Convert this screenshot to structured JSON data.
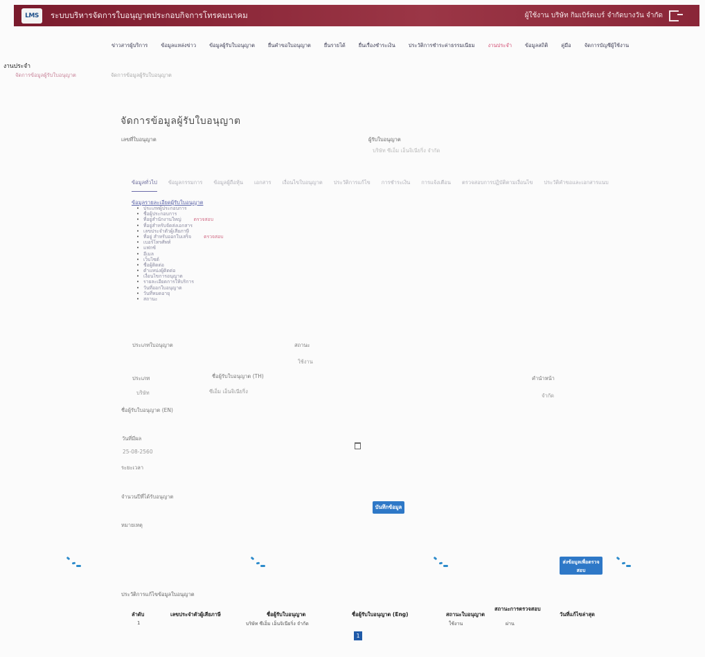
{
  "header": {
    "logo_text": "LMS",
    "app_title": "ระบบบริหารจัดการใบอนุญาตประกอบกิจการโทรคมนาคม",
    "user_text": "ผู้ใช้งาน บริษัท กิมเบิร์ดเบร์ จำกัดบางวัน จำกัด"
  },
  "nav": {
    "items": [
      {
        "label": "ข่าวสารผู้บริการ"
      },
      {
        "label": "ข้อมูลแหล่งข่าว"
      },
      {
        "label": "ข้อมูลผู้รับใบอนุญาต"
      },
      {
        "label": "ยื่นคำขอใบอนุญาต"
      },
      {
        "label": "ยื่นรายได้"
      },
      {
        "label": "ยื่นเรื่องชำระเงิน"
      },
      {
        "label": "ประวัติการชำระค่าธรรมเนียม"
      },
      {
        "label": "งานประจำ"
      },
      {
        "label": "ข้อมูลสถิติ"
      },
      {
        "label": "คู่มือ"
      },
      {
        "label": "จัดการบัญชีผู้ใช้งาน"
      }
    ]
  },
  "sidebar": {
    "title": "งานประจำ",
    "link": "จัดการข้อมูลผู้รับใบอนุญาต"
  },
  "breadcrumb": "จัดการข้อมูลผู้รับใบอนุญาต",
  "page_title": "จัดการข้อมูลผู้รับใบอนุญาต",
  "fields": {
    "license_number_label": "เลขที่ใบอนุญาต",
    "license_number_value": "",
    "licensee_label": "ผู้รับใบอนุญาต",
    "licensee_value": "บริษัท ซีเอ็ม เอ็นจิเนียริ่ง จำกัด"
  },
  "tabs": [
    {
      "label": "ข้อมูลทั่วไป",
      "active": true
    },
    {
      "label": "ข้อมูลกรรมการ"
    },
    {
      "label": "ข้อมูลผู้ถือหุ้น"
    },
    {
      "label": "เอกสาร"
    },
    {
      "label": "เงื่อนไขใบอนุญาต"
    },
    {
      "label": "ประวัติการแก้ไข"
    },
    {
      "label": "การชำระเงิน"
    },
    {
      "label": "การแจ้งเตือน"
    },
    {
      "label": "ตรวจสอบการปฏิบัติตามเงื่อนไข"
    },
    {
      "label": "ประวัติคำขอและเอกสารแนบ"
    }
  ],
  "section_heading": "ข้อมูลรายละเอียดผู้รับใบอนุญาต",
  "doc_items": [
    {
      "text": "ประเภทผู้ประกอบการ",
      "hl": ""
    },
    {
      "text": "ชื่อผู้ประกอบการ",
      "hl": ""
    },
    {
      "text": "ที่อยู่สำนักงานใหญ่",
      "hl": "ตรวจสอบ"
    },
    {
      "text": "ที่อยู่สำหรับจัดส่งเอกสาร",
      "hl": ""
    },
    {
      "text": "เลขประจำตัวผู้เสียภาษี",
      "hl": ""
    },
    {
      "text": "ที่อยู่ สำหรับออกใบเสร็จ",
      "hl": "ตรวจสอบ"
    },
    {
      "text": "เบอร์โทรศัพท์",
      "hl": ""
    },
    {
      "text": "แฟกซ์",
      "hl": ""
    },
    {
      "text": "อีเมล",
      "hl": ""
    },
    {
      "text": "เว็บไซต์",
      "hl": ""
    },
    {
      "text": "ชื่อผู้ติดต่อ",
      "hl": ""
    },
    {
      "text": "ตำแหน่งผู้ติดต่อ",
      "hl": ""
    },
    {
      "text": "เงื่อนไขการอนุญาต",
      "hl": ""
    },
    {
      "text": "รายละเอียดการให้บริการ",
      "hl": ""
    },
    {
      "text": "วันที่ออกใบอนุญาต",
      "hl": ""
    },
    {
      "text": "วันที่หมดอายุ",
      "hl": ""
    },
    {
      "text": "สถานะ",
      "hl": ""
    }
  ],
  "form": {
    "license_type_label": "ประเภทใบอนุญาต",
    "license_type_value": "",
    "status_label": "สถานะ",
    "status_value": "ใช้งาน",
    "company_label": "ประเภท",
    "company_value": "บริษัท",
    "name_label": "ชื่อผู้รับใบอนุญาต (TH)",
    "name_value": "ซีเอ็ม เอ็นจิเนียริ่ง",
    "right_label": "คำนำหน้า",
    "right_value": "จำกัด",
    "eng_name_label": "ชื่อผู้รับใบอนุญาต (EN)",
    "eng_name_value": "",
    "date_label": "วันที่มีผล",
    "date_value": "25-08-2560",
    "field2_label": "ระยะเวลา",
    "field2_value": "",
    "field3_label": "จำนวนปีที่ได้รับอนุญาต",
    "field3_value": "",
    "field4_label": "หมายเหตุ",
    "field4_value": "",
    "save_button": "บันทึกข้อมูล",
    "submit_button": "ส่งข้อมูลเพื่อตรวจสอบ"
  },
  "history_table": {
    "caption": "ประวัติการแก้ไขข้อมูลใบอนุญาต",
    "columns": [
      "ลำดับ",
      "เลขประจำตัวผู้เสียภาษี",
      "ชื่อผู้รับใบอนุญาต",
      "ชื่อผู้รับใบอนุญาต (Eng)",
      "สถานะใบอนุญาต",
      "สถานะการตรวจสอบ",
      "วันที่แก้ไขล่าสุด"
    ],
    "rows": [
      [
        "1",
        "",
        "บริษัท ซีเอ็ม เอ็นจิเนียริ่ง จำกัด",
        "",
        "ใช้งาน",
        "ผ่าน",
        ""
      ]
    ],
    "page": "1"
  },
  "footer_note": "",
  "colors": {
    "header": "#8e2a3b",
    "accent": "#2e78c7",
    "active_nav": "#d24d73"
  }
}
